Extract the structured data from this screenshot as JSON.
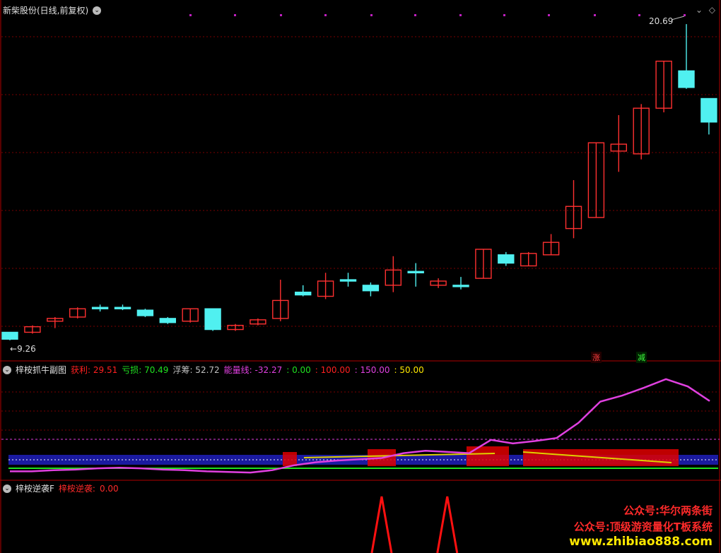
{
  "main_panel": {
    "title": "新柴股份(日线,前复权)",
    "high_label": "20.69",
    "low_label": "9.26",
    "marker_up": "涨",
    "marker_down": "减"
  },
  "indicator1": {
    "name": "梓桉抓牛副图",
    "items": [
      {
        "key": "获利",
        "label": "获利:",
        "value": "29.51",
        "color": "#ff2020"
      },
      {
        "key": "亏损",
        "label": "亏损:",
        "value": "70.49",
        "color": "#20e020"
      },
      {
        "key": "浮筹",
        "label": "浮筹:",
        "value": "52.72",
        "color": "#c0c0c0"
      },
      {
        "key": "能量线",
        "label": "能量线:",
        "value": "-32.27",
        "color": "#e040e0"
      },
      {
        "key": "l1",
        "label": ":",
        "value": "0.00",
        "color": "#20e020"
      },
      {
        "key": "l2",
        "label": ":",
        "value": "100.00",
        "color": "#ff2020"
      },
      {
        "key": "l3",
        "label": ":",
        "value": "150.00",
        "color": "#e040e0"
      },
      {
        "key": "l4",
        "label": ":",
        "value": "50.00",
        "color": "#ffe800"
      }
    ]
  },
  "indicator2": {
    "name": "梓桉逆袭F",
    "label": "梓桉逆袭:",
    "value": "0.00"
  },
  "promo": {
    "line1": "公众号:华尔两条街",
    "line2": "公众号:顶级游资量化T板系统",
    "url": "www.zhibiao888.com"
  },
  "colors": {
    "up": "#ff3030",
    "down": "#50f0f0",
    "grid": "#7a0000",
    "energy": "#e040e0"
  },
  "chart_data": {
    "type": "candlestick",
    "candles": [
      {
        "o": 9.55,
        "c": 9.3,
        "h": 9.55,
        "l": 9.26
      },
      {
        "o": 9.55,
        "c": 9.75,
        "h": 9.8,
        "l": 9.5
      },
      {
        "o": 9.95,
        "c": 10.05,
        "h": 10.1,
        "l": 9.7
      },
      {
        "o": 10.1,
        "c": 10.4,
        "h": 10.45,
        "l": 10.05
      },
      {
        "o": 10.45,
        "c": 10.4,
        "h": 10.55,
        "l": 10.3
      },
      {
        "o": 10.45,
        "c": 10.42,
        "h": 10.55,
        "l": 10.35
      },
      {
        "o": 10.35,
        "c": 10.15,
        "h": 10.4,
        "l": 10.1
      },
      {
        "o": 10.05,
        "c": 9.9,
        "h": 10.1,
        "l": 9.85
      },
      {
        "o": 9.95,
        "c": 10.4,
        "h": 10.4,
        "l": 9.9
      },
      {
        "o": 10.4,
        "c": 9.65,
        "h": 10.4,
        "l": 9.6
      },
      {
        "o": 9.65,
        "c": 9.8,
        "h": 9.85,
        "l": 9.6
      },
      {
        "o": 9.85,
        "c": 10.0,
        "h": 10.05,
        "l": 9.8
      },
      {
        "o": 10.05,
        "c": 10.7,
        "h": 11.45,
        "l": 9.95
      },
      {
        "o": 11.0,
        "c": 10.9,
        "h": 11.25,
        "l": 10.85
      },
      {
        "o": 10.85,
        "c": 11.4,
        "h": 11.7,
        "l": 10.75
      },
      {
        "o": 11.45,
        "c": 11.4,
        "h": 11.7,
        "l": 11.2
      },
      {
        "o": 11.25,
        "c": 11.05,
        "h": 11.35,
        "l": 10.85
      },
      {
        "o": 11.25,
        "c": 11.8,
        "h": 12.3,
        "l": 11.0
      },
      {
        "o": 11.75,
        "c": 11.7,
        "h": 12.05,
        "l": 11.2
      },
      {
        "o": 11.25,
        "c": 11.4,
        "h": 11.5,
        "l": 11.15
      },
      {
        "o": 11.25,
        "c": 11.2,
        "h": 11.55,
        "l": 11.1
      },
      {
        "o": 11.5,
        "c": 12.55,
        "h": 12.55,
        "l": 11.5
      },
      {
        "o": 12.35,
        "c": 12.05,
        "h": 12.45,
        "l": 11.95
      },
      {
        "o": 11.95,
        "c": 12.4,
        "h": 12.45,
        "l": 11.95
      },
      {
        "o": 12.35,
        "c": 12.8,
        "h": 13.1,
        "l": 12.35
      },
      {
        "o": 13.3,
        "c": 14.1,
        "h": 15.05,
        "l": 12.95
      },
      {
        "o": 13.7,
        "c": 16.4,
        "h": 16.4,
        "l": 13.7
      },
      {
        "o": 16.1,
        "c": 16.35,
        "h": 17.4,
        "l": 15.35
      },
      {
        "o": 16.0,
        "c": 17.65,
        "h": 17.8,
        "l": 15.8
      },
      {
        "o": 17.65,
        "c": 19.35,
        "h": 19.35,
        "l": 17.5
      },
      {
        "o": 19.0,
        "c": 18.4,
        "h": 20.69,
        "l": 18.35
      },
      {
        "o": 18.0,
        "c": 17.15,
        "h": 18.0,
        "l": 16.7
      }
    ],
    "energy_line": [
      -60,
      -60,
      -58,
      -57,
      -55,
      -54,
      -55,
      -57,
      -58,
      -60,
      -61,
      -62,
      -58,
      -50,
      -45,
      -42,
      -40,
      -38,
      -30,
      -26,
      -28,
      -30,
      -8,
      -14,
      -10,
      -5,
      20,
      55,
      65,
      78,
      92,
      80,
      56
    ],
    "levels": [
      0,
      50,
      100,
      150
    ],
    "signal": [
      0,
      0,
      0,
      0,
      0,
      0,
      0,
      0,
      0,
      0,
      0,
      0,
      0,
      0,
      0,
      0,
      0,
      1,
      0,
      0,
      1,
      0,
      0,
      0,
      0,
      0,
      0,
      0,
      0,
      0,
      0,
      0,
      0
    ]
  }
}
